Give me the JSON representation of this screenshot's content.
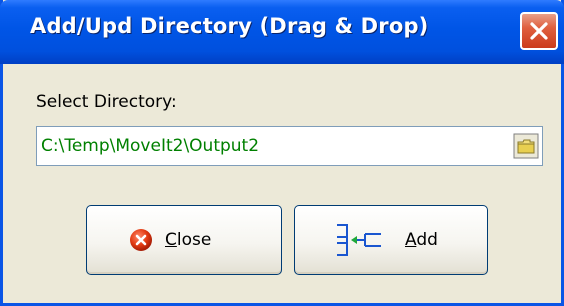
{
  "window": {
    "title": "Add/Upd Directory (Drag & Drop)"
  },
  "form": {
    "label": "Select Directory:",
    "directory_value": "C:\\Temp\\MoveIt2\\Output2"
  },
  "buttons": {
    "close_access_key": "C",
    "close_rest": "lose",
    "add_access_key": "A",
    "add_rest": "dd"
  },
  "icons": {
    "title_close": "close-x-icon",
    "browse": "folder-icon",
    "close": "red-x-circle-icon",
    "add": "add-directory-icon"
  },
  "colors": {
    "titlebar": "#0055e6",
    "field_text": "#008000",
    "window_bg": "#ece9d8"
  }
}
